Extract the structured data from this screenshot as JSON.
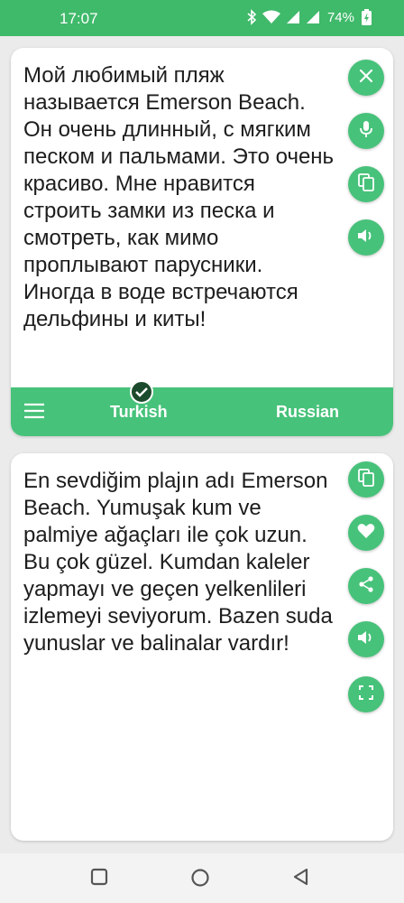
{
  "status_bar": {
    "time": "17:07",
    "battery_percent": "74%",
    "icons": [
      "bluetooth-icon",
      "wifi-icon",
      "signal-icon",
      "signal-icon",
      "battery-icon"
    ]
  },
  "source_panel": {
    "text": "Мой любимый пляж называется Emerson Beach. Он очень длинный, с мягким песком и пальмами. Это очень красиво. Мне нравится строить замки из песка и смотреть, как мимо проплывают парусники. Иногда в воде встречаются дельфины и киты!",
    "actions": [
      "close-icon",
      "microphone-icon",
      "copy-icon",
      "speaker-icon"
    ]
  },
  "language_bar": {
    "source_language": "Turkish",
    "target_language": "Russian",
    "icons": [
      "menu-icon",
      "check-icon"
    ]
  },
  "target_panel": {
    "text": "En sevdiğim plajın adı Emerson Beach. Yumuşak kum ve palmiye ağaçları ile çok uzun. Bu çok güzel. Kumdan kaleler yapmayı ve geçen yelkenlileri izlemeyi seviyorum. Bazen suda yunuslar ve balinalar vardır!",
    "actions": [
      "copy-icon",
      "heart-icon",
      "share-icon",
      "speaker-icon",
      "fullscreen-icon"
    ]
  },
  "nav_bar": {
    "buttons": [
      "recents-icon",
      "home-icon",
      "back-icon"
    ]
  },
  "colors": {
    "accent": "#47c27a",
    "status_bar": "#3fb96a",
    "badge": "#1c4a2c"
  }
}
